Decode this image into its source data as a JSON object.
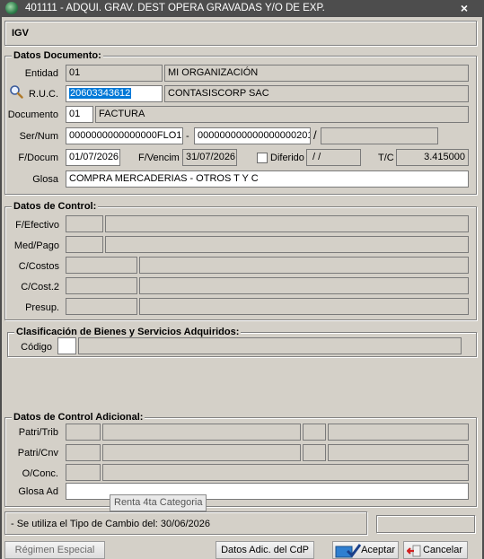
{
  "window": {
    "title": "401111 - ADQUI. GRAV. DEST OPERA GRAVADAS Y/O DE EXP.",
    "close_glyph": "×"
  },
  "header": {
    "tax_label": "IGV"
  },
  "datos_documento": {
    "legend": "Datos Documento:",
    "entidad_label": "Entidad",
    "entidad_code": "01",
    "entidad_name": "MI ORGANIZACIÓN",
    "ruc_label": "R.U.C.",
    "ruc_value": "20603343612",
    "ruc_name": "CONTASISCORP SAC",
    "documento_label": "Documento",
    "documento_code": "01",
    "documento_name": "FACTURA",
    "sernum_label": "Ser/Num",
    "serie": "0000000000000000FLO1",
    "sep_dash": "-",
    "numero": "000000000000000000201",
    "sep_slash": "/",
    "extra": "",
    "fdocum_label": "F/Docum",
    "fdocum": "01/07/2026",
    "fvencim_label": "F/Vencim",
    "fvencim": "31/07/2026",
    "diferido_label": "Diferido",
    "diferido_value": " / /",
    "tc_label": "T/C",
    "tc_value": "3.415000",
    "glosa_label": "Glosa",
    "glosa_value": "COMPRA MERCADERIAS - OTROS T Y C"
  },
  "datos_control": {
    "legend": "Datos de Control:",
    "fefectivo_label": "F/Efectivo",
    "medpago_label": "Med/Pago",
    "ccostos_label": "C/Costos",
    "ccost2_label": "C/Cost.2",
    "presup_label": "Presup."
  },
  "clasificacion": {
    "legend": "Clasificación de Bienes y Servicios Adquiridos:",
    "codigo_label": "Código"
  },
  "control_adicional": {
    "legend": "Datos de Control Adicional:",
    "patritrib_label": "Patri/Trib",
    "patricnv_label": "Patri/Cnv",
    "oconc_label": "O/Conc.",
    "glosaad_label": "Glosa Ad",
    "tooltip": "Renta 4ta Categoria"
  },
  "status": {
    "message": "- Se utiliza el Tipo de Cambio del: 30/06/2026"
  },
  "buttons": {
    "regimen": "Régimen Especial",
    "datos_adic": "Datos Adic. del CdP",
    "aceptar": "Aceptar",
    "cancelar": "Cancelar"
  }
}
